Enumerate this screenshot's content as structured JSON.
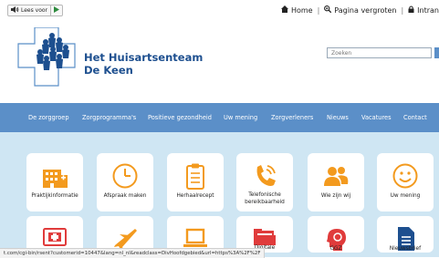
{
  "toolbar": {
    "read_aloud_label": "Lees voor"
  },
  "toplinks": {
    "home": "Home",
    "zoom": "Pagina vergroten",
    "intranet": "Intran"
  },
  "logo": {
    "line1": "Het Huisartsenteam",
    "line2": "De Keen"
  },
  "search": {
    "placeholder": "Zoeken"
  },
  "nav": [
    "De zorggroep",
    "Zorgprogramma's",
    "Positieve gezondheid",
    "Uw mening",
    "Zorgverleners",
    "Nieuws",
    "Vacatures",
    "Contact"
  ],
  "tiles": {
    "praktijkinformatie": "Praktijkinformatie",
    "afspraak": "Afspraak maken",
    "herhaalrecept": "Herhaalrecept",
    "telefonisch_1": "Telefonische",
    "telefonisch_2": "bereikbaarheid",
    "wiezijnwij": "Wie zijn wij",
    "uwmening": "Uw mening",
    "digitale": "Digitale",
    "ggz": "GGZ",
    "nieuwsbrief": "Nieuwsbrief"
  },
  "status_url": "t.com/cgi-bin/rsent?customerid=10447&lang=nl_nl&readclass=DivHoofdgebied&url=https%3A%2F%2F",
  "colors": {
    "nav": "#5b8fc8",
    "content_bg": "#cfe6f3",
    "icon_orange": "#f39a1e",
    "icon_red": "#e03b3b",
    "brand": "#1d4f8f"
  }
}
